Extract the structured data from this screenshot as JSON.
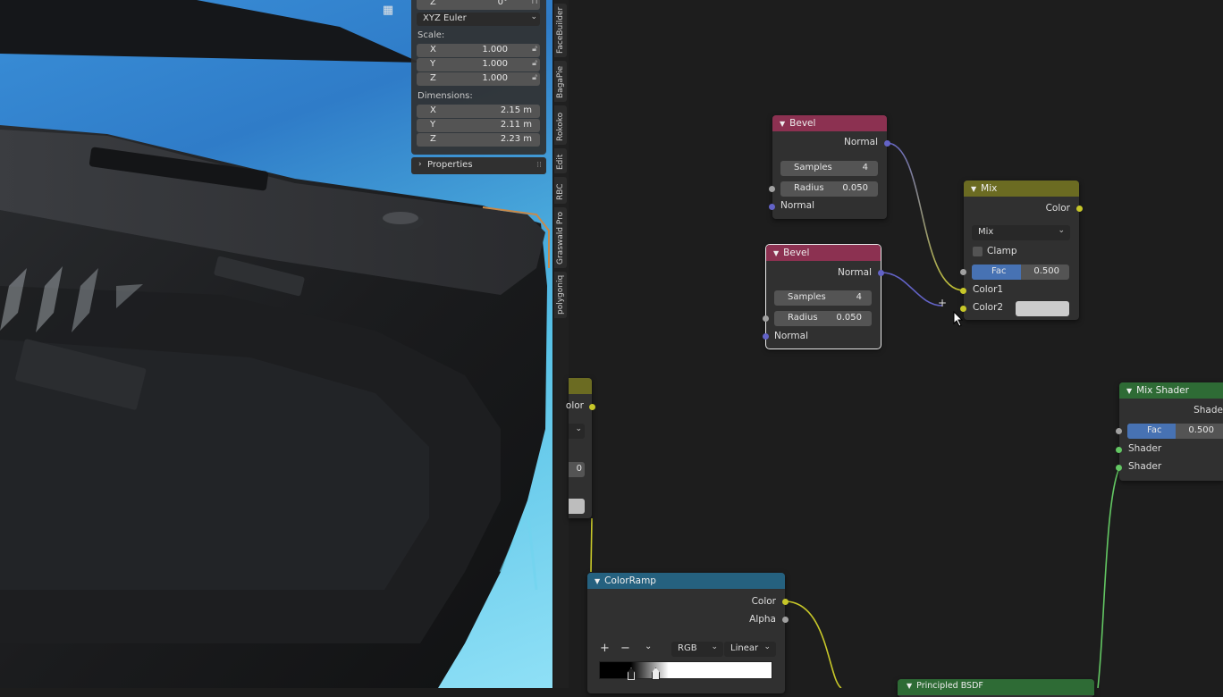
{
  "viewport": {
    "gizmo_icon": "grid-icon",
    "npanel": {
      "rotation_z_label": "Z",
      "rotation_z_value": "0°",
      "rotation_mode": "XYZ Euler",
      "scale_label": "Scale:",
      "scale": [
        {
          "axis": "X",
          "value": "1.000"
        },
        {
          "axis": "Y",
          "value": "1.000"
        },
        {
          "axis": "Z",
          "value": "1.000"
        }
      ],
      "dimensions_label": "Dimensions:",
      "dimensions": [
        {
          "axis": "X",
          "value": "2.15 m"
        },
        {
          "axis": "Y",
          "value": "2.11 m"
        },
        {
          "axis": "Z",
          "value": "2.23 m"
        }
      ],
      "properties_label": "Properties"
    }
  },
  "tabs": [
    "FaceBuilder",
    "BagaPie",
    "Rokoko",
    "Edit",
    "RBC",
    "Graswald Pro",
    "polygoniq"
  ],
  "nodes": {
    "bevel1": {
      "title": "Bevel",
      "out_normal": "Normal",
      "samples_label": "Samples",
      "samples": "4",
      "radius_label": "Radius",
      "radius": "0.050",
      "in_normal": "Normal"
    },
    "bevel2": {
      "title": "Bevel",
      "out_normal": "Normal",
      "samples_label": "Samples",
      "samples": "4",
      "radius_label": "Radius",
      "radius": "0.050",
      "in_normal": "Normal"
    },
    "mix": {
      "title": "Mix",
      "out_color": "Color",
      "blend": "Mix",
      "clamp": "Clamp",
      "fac_label": "Fac",
      "fac": "0.500",
      "color1": "Color1",
      "color2": "Color2"
    },
    "mix_shader": {
      "title": "Mix Shader",
      "out_shader": "Shade",
      "fac_label": "Fac",
      "fac": "0.500",
      "shader1": "Shader",
      "shader2": "Shader"
    },
    "colorramp": {
      "title": "ColorRamp",
      "out_color": "Color",
      "out_alpha": "Alpha",
      "add": "+",
      "remove": "−",
      "mode": "RGB",
      "interp": "Linear"
    },
    "partial_left": {
      "out_color": "olor",
      "value": "0"
    },
    "principled": {
      "title": "Principled BSDF"
    }
  },
  "colors": {
    "node_pink": "#8c3151",
    "node_olive": "#6b6b22",
    "node_teal": "#25617f",
    "node_green": "#2e6b35",
    "accent": "#4772b3"
  }
}
